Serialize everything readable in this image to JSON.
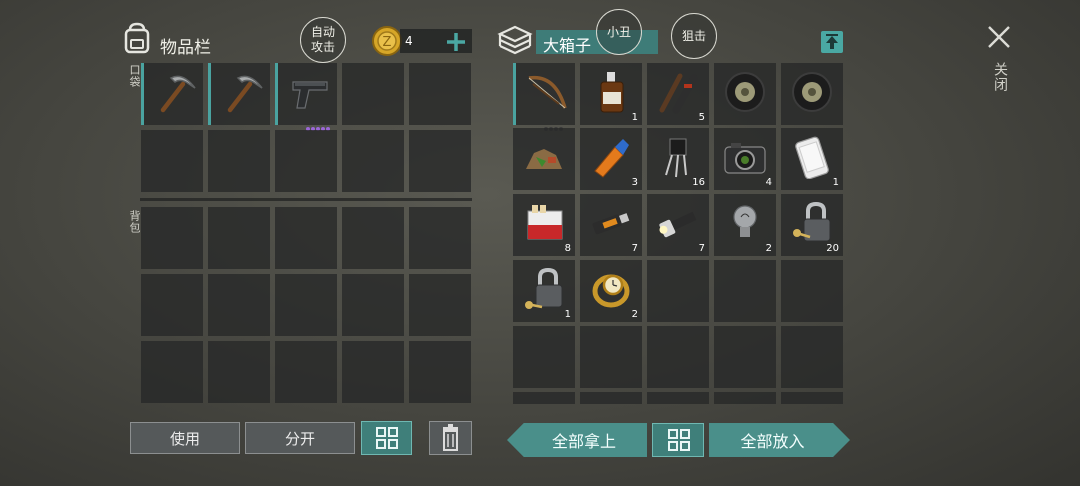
{
  "inventory": {
    "title": "物品栏",
    "auto_attack": "自动攻击",
    "coins": "4",
    "pocket_label": "口袋",
    "backpack_label": "背包",
    "pocket_items": [
      {
        "name": "pickaxe-icon",
        "count": ""
      },
      {
        "name": "pickaxe-icon",
        "count": ""
      },
      {
        "name": "pistol-icon",
        "count": ""
      }
    ]
  },
  "container": {
    "title": "大箱子",
    "xiaochou": "小丑",
    "snipe": "狙击",
    "items": [
      {
        "name": "crossbow-icon",
        "count": ""
      },
      {
        "name": "whiskey-bottle-icon",
        "count": "1"
      },
      {
        "name": "scope-parts-icon",
        "count": "5"
      },
      {
        "name": "tire-icon",
        "count": ""
      },
      {
        "name": "tire-icon",
        "count": ""
      },
      {
        "name": "scrap-pile-icon",
        "count": ""
      },
      {
        "name": "glue-tube-icon",
        "count": "3"
      },
      {
        "name": "transistor-icon",
        "count": "16"
      },
      {
        "name": "camera-icon",
        "count": "4"
      },
      {
        "name": "smartphone-icon",
        "count": "1"
      },
      {
        "name": "cigarettes-icon",
        "count": "8"
      },
      {
        "name": "usb-drive-icon",
        "count": "7"
      },
      {
        "name": "flashlight-icon",
        "count": "7"
      },
      {
        "name": "lightbulb-icon",
        "count": "2"
      },
      {
        "name": "padlock-key-icon",
        "count": "20"
      },
      {
        "name": "padlock-key-icon",
        "count": "1"
      },
      {
        "name": "gold-watch-icon",
        "count": "2"
      }
    ]
  },
  "close_label": "关闭",
  "buttons": {
    "use": "使用",
    "split": "分开",
    "take_all": "全部拿上",
    "put_all": "全部放入"
  },
  "colors": {
    "accent": "#4a8f8a",
    "slot": "#262828",
    "rarity_purple": "#9c67d8"
  }
}
